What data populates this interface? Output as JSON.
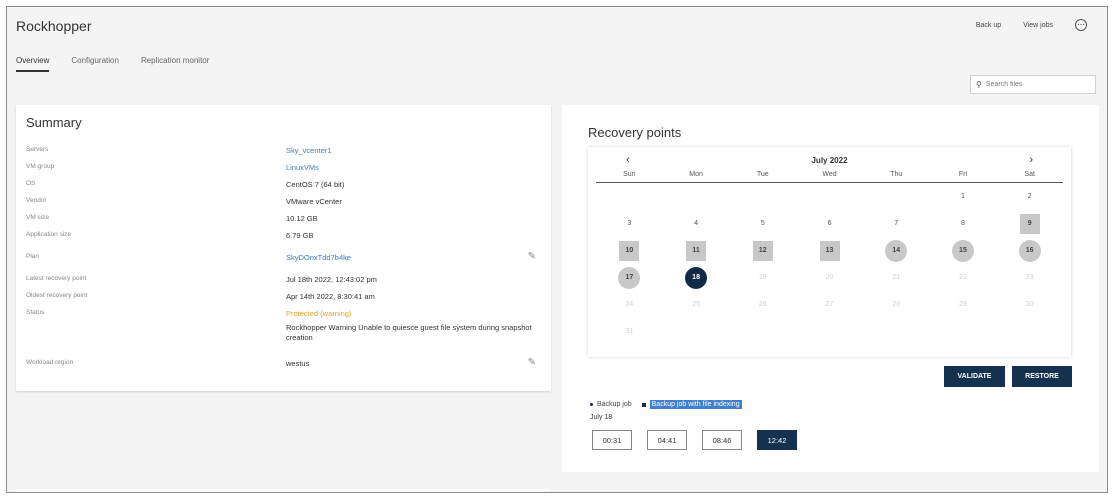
{
  "app": {
    "title": "Rockhopper"
  },
  "top_actions": {
    "backup": "Back up",
    "view_jobs": "View jobs"
  },
  "tabs": [
    {
      "label": "Overview",
      "active": true
    },
    {
      "label": "Configuration",
      "active": false
    },
    {
      "label": "Replication monitor",
      "active": false
    }
  ],
  "search": {
    "placeholder": "Search files"
  },
  "summary": {
    "title": "Summary",
    "rows": [
      {
        "label": "Servers",
        "value": "Sky_vcenter1"
      },
      {
        "label": "VM group",
        "value": "LinuxVMs"
      },
      {
        "label": "OS",
        "value": "CentOS 7 (64 bit)"
      },
      {
        "label": "Vendor",
        "value": "VMware vCenter"
      },
      {
        "label": "VM size",
        "value": "10.12 GB"
      },
      {
        "label": "Application size",
        "value": "6.79 GB"
      },
      {
        "label": "Plan",
        "value": "SkyDOnxTdd7b4ke"
      },
      {
        "label": "Latest recovery point",
        "value": "Jul 18th 2022, 12:43:02 pm"
      },
      {
        "label": "Oldest recovery point",
        "value": "Apr 14th 2022, 8:30:41 am"
      },
      {
        "label": "Status",
        "value": "Protected (warning)",
        "message": "Rockhopper Warning Unable to quiesce guest file system during snapshot creation"
      },
      {
        "label": "Workload region",
        "value": "westus"
      }
    ]
  },
  "recovery": {
    "title": "Recovery points",
    "calendar": {
      "month": "July 2022",
      "prev": "‹",
      "next": "›",
      "days_of_week": [
        "Sun",
        "Mon",
        "Tue",
        "Wed",
        "Thu",
        "Fri",
        "Sat"
      ],
      "weeks": [
        [
          "",
          "",
          "",
          "",
          "",
          "1",
          "2"
        ],
        [
          "3",
          "4",
          "5",
          "6",
          "7",
          "8",
          "9"
        ],
        [
          "10",
          "11",
          "12",
          "13",
          "14",
          "15",
          "16"
        ],
        [
          "17",
          "18",
          "19",
          "20",
          "21",
          "22",
          "23"
        ],
        [
          "24",
          "25",
          "26",
          "27",
          "28",
          "29",
          "30"
        ],
        [
          "31",
          "",
          "",
          "",
          "",
          "",
          ""
        ]
      ],
      "selected_day": "18"
    },
    "validate_label": "VALIDATE",
    "restore_label": "RESTORE",
    "legend": {
      "backup_job": "Backup job",
      "backup_job_indexing": "Backup job with file indexing"
    },
    "date_label": "July 18",
    "times": [
      "00:31",
      "04:41",
      "08:46",
      "12:42"
    ],
    "active_time": "12:42"
  },
  "colors": {
    "accent_dark": "#14314f",
    "link": "#3d7ec0",
    "warning": "#e6a22b",
    "highlight": "#3f7fcc"
  }
}
